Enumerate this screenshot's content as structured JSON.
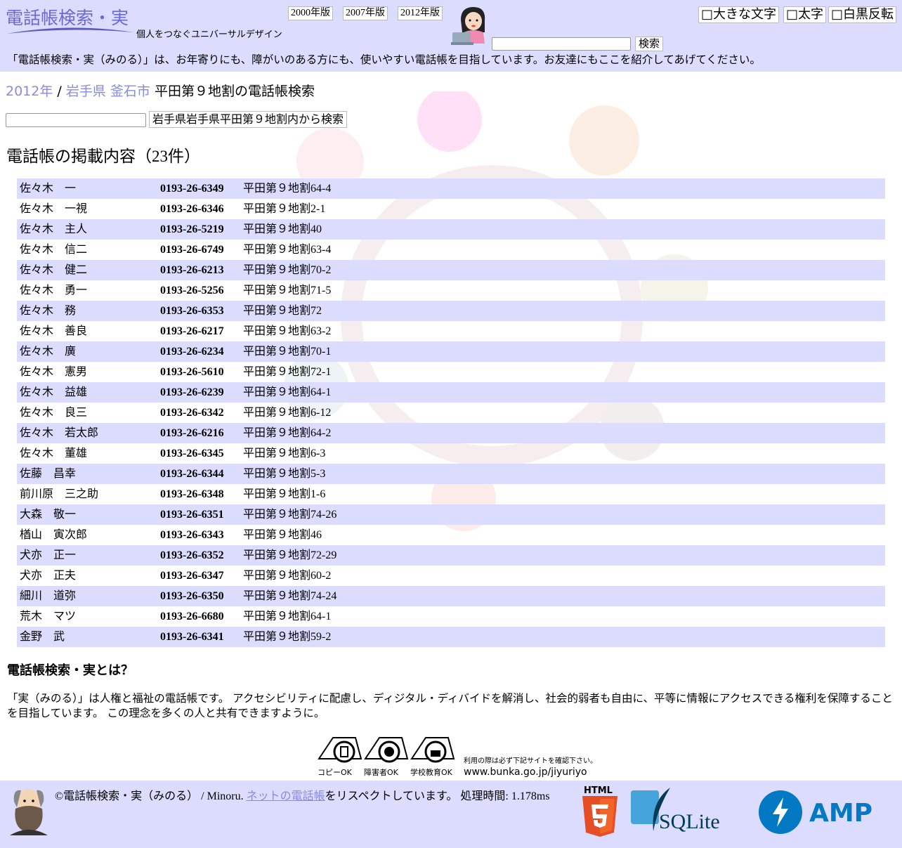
{
  "header": {
    "logo_title": "電話帳検索・実",
    "tagline": "個人をつなぐユニバーサルデザイン",
    "editions": [
      "2000年版",
      "2007年版",
      "2012年版"
    ],
    "search_button": "検索",
    "options": [
      "□大きな文字",
      "□太字",
      "□白黒反転"
    ],
    "intro": "「電話帳検索・実（みのる）」は、お年寄りにも、障がいのある方にも、使いやすい電話帳を目指しています。お友達にもここを紹介してあげてください。"
  },
  "breadcrumb": {
    "year": "2012年",
    "separator": " / ",
    "prefecture": "岩手県",
    "city": "釜石市",
    "current": " 平田第９地割の電話帳検索"
  },
  "local_search_button": "岩手県岩手県平田第９地割内から検索",
  "listing_heading": "電話帳の掲載内容（23件）",
  "listings": [
    {
      "name": "佐々木　一",
      "phone": "0193-26-6349",
      "address": "平田第９地割64-4"
    },
    {
      "name": "佐々木　一視",
      "phone": "0193-26-6346",
      "address": "平田第９地割2-1"
    },
    {
      "name": "佐々木　主人",
      "phone": "0193-26-5219",
      "address": "平田第９地割40"
    },
    {
      "name": "佐々木　信二",
      "phone": "0193-26-6749",
      "address": "平田第９地割63-4"
    },
    {
      "name": "佐々木　健二",
      "phone": "0193-26-6213",
      "address": "平田第９地割70-2"
    },
    {
      "name": "佐々木　勇一",
      "phone": "0193-26-5256",
      "address": "平田第９地割71-5"
    },
    {
      "name": "佐々木　務",
      "phone": "0193-26-6353",
      "address": "平田第９地割72"
    },
    {
      "name": "佐々木　善良",
      "phone": "0193-26-6217",
      "address": "平田第９地割63-2"
    },
    {
      "name": "佐々木　廣",
      "phone": "0193-26-6234",
      "address": "平田第９地割70-1"
    },
    {
      "name": "佐々木　憲男",
      "phone": "0193-26-5610",
      "address": "平田第９地割72-1"
    },
    {
      "name": "佐々木　益雄",
      "phone": "0193-26-6239",
      "address": "平田第９地割64-1"
    },
    {
      "name": "佐々木　良三",
      "phone": "0193-26-6342",
      "address": "平田第９地割6-12"
    },
    {
      "name": "佐々木　若太郎",
      "phone": "0193-26-6216",
      "address": "平田第９地割64-2"
    },
    {
      "name": "佐々木　董雄",
      "phone": "0193-26-6345",
      "address": "平田第９地割6-3"
    },
    {
      "name": "佐藤　昌幸",
      "phone": "0193-26-6344",
      "address": "平田第９地割5-3"
    },
    {
      "name": "前川原　三之助",
      "phone": "0193-26-6348",
      "address": "平田第９地割1-6"
    },
    {
      "name": "大森　敬一",
      "phone": "0193-26-6351",
      "address": "平田第９地割74-26"
    },
    {
      "name": "楢山　寅次郎",
      "phone": "0193-26-6343",
      "address": "平田第９地割46"
    },
    {
      "name": "犬亦　正一",
      "phone": "0193-26-6352",
      "address": "平田第９地割72-29"
    },
    {
      "name": "犬亦　正夫",
      "phone": "0193-26-6347",
      "address": "平田第９地割60-2"
    },
    {
      "name": "細川　道弥",
      "phone": "0193-26-6350",
      "address": "平田第９地割74-24"
    },
    {
      "name": "荒木　マツ",
      "phone": "0193-26-6680",
      "address": "平田第９地割64-1"
    },
    {
      "name": "金野　武",
      "phone": "0193-26-6341",
      "address": "平田第９地割59-2"
    }
  ],
  "about": {
    "heading": "電話帳検索・実とは？",
    "text": "「実（みのる）」は人権と福祉の電話帳です。 アクセシビリティに配慮し、ディジタル・ディバイドを解消し、社会的弱者も自由に、平等に情報にアクセスできる権利を保障することを目指しています。 この理念を多くの人と共有できますように。"
  },
  "copyright_marks": {
    "labels": [
      "コピーOK",
      "障害者OK",
      "学校教育OK"
    ],
    "notice": "利用の際は必ず下記サイトを確認下さい。",
    "url": "www.bunka.go.jp/jiyuriyo"
  },
  "footer": {
    "copyright": "©電話帳検索・実（みのる） / Minoru. ",
    "link": "ネットの電話帳",
    "respect": "をリスペクトしています。 処理時間: 1.178ms",
    "html5_label": "HTML",
    "sqlite_label": "SQLite",
    "amp_label": "AMP"
  },
  "colors": {
    "header_bg": "#dcdcff",
    "row_stripe": "#dcdcff",
    "link": "#8a8adf",
    "html5": "#e44d26",
    "sqlite": "#0f80cc",
    "amp": "#0379c4"
  }
}
